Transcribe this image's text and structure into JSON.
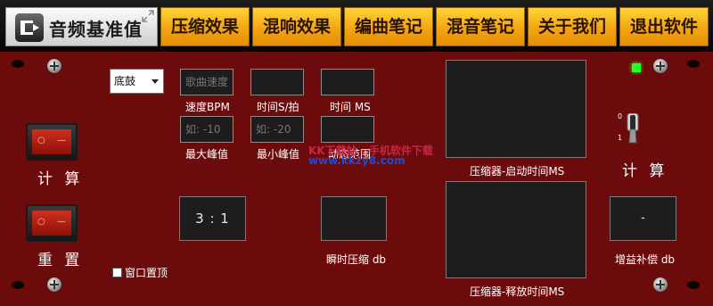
{
  "app": {
    "title": "音频基准值"
  },
  "tabs": [
    {
      "label": "压缩效果"
    },
    {
      "label": "混响效果"
    },
    {
      "label": "编曲笔记"
    },
    {
      "label": "混音笔记"
    },
    {
      "label": "关于我们"
    },
    {
      "label": "退出软件"
    }
  ],
  "left": {
    "calc_label": "计 算",
    "reset_label": "重 置",
    "pin_label": "窗口置顶"
  },
  "drum_select": {
    "value": "底鼓"
  },
  "fields": {
    "bpm": {
      "placeholder": "歌曲速度",
      "label": "速度BPM"
    },
    "time_s_beat": {
      "value": "",
      "label": "时间S/拍"
    },
    "time_ms": {
      "value": "",
      "label": "时间 MS"
    },
    "max_peak": {
      "placeholder": "如: -10",
      "label": "最大峰值"
    },
    "min_peak": {
      "placeholder": "如: -20",
      "label": "最小峰值"
    },
    "dynamic_range": {
      "value": "",
      "label": "动态范围"
    }
  },
  "ratio": {
    "value": "3 : 1"
  },
  "instant_compress": {
    "value": "",
    "label": "瞬时压缩 db"
  },
  "attack": {
    "label": "压缩器-启动时间MS"
  },
  "release": {
    "label": "压缩器-释放时间MS"
  },
  "gain": {
    "value": "-",
    "label": "增益补偿 db"
  },
  "right": {
    "calc_label": "计 算"
  },
  "switch_marks": {
    "on": "0",
    "off": "1"
  },
  "watermark": {
    "line1": "KK下载站 - 手机软件下载",
    "line2": "www.kkzy8.com"
  },
  "colors": {
    "panel": "#6c0b0b",
    "tab_gold": "#f3a510",
    "led": "#26ff2a"
  }
}
